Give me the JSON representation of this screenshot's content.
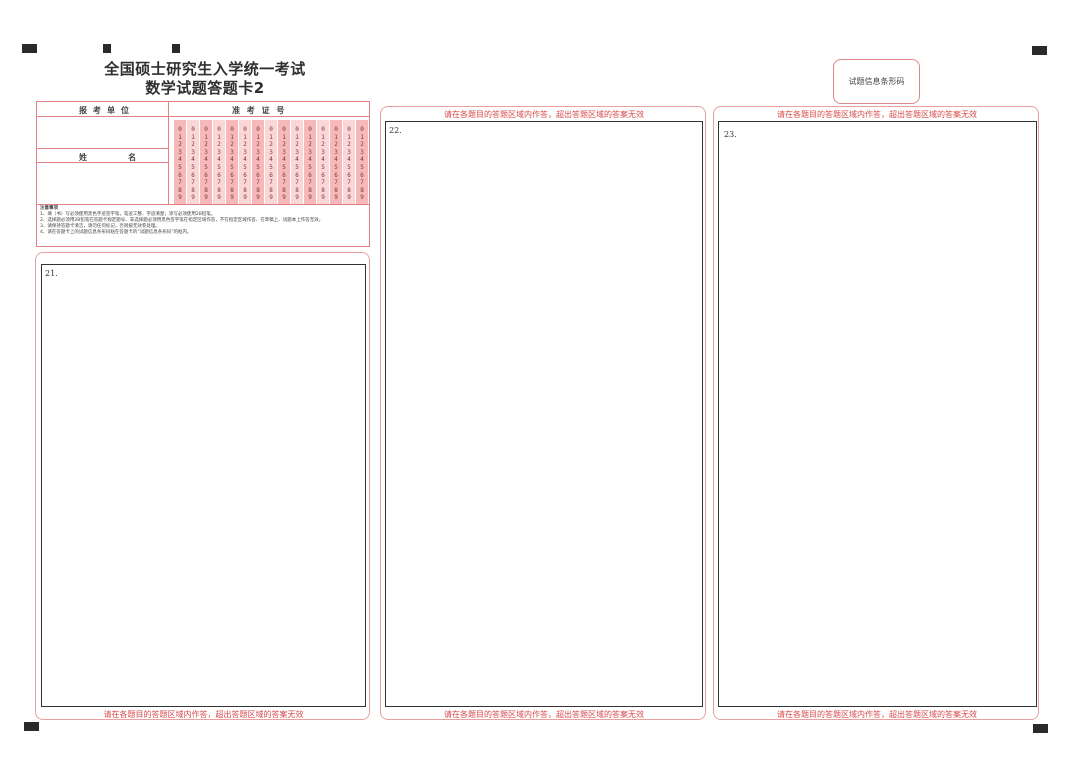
{
  "title_line1": "全国硕士研究生入学统一考试",
  "title_line2": "数学试题答题卡2",
  "barcode_label": "试题信息条形码",
  "info": {
    "unit_label": "报考单位",
    "name_label": "姓    名",
    "exam_no_label": "准 考 证 号",
    "digits": [
      "0",
      "1",
      "2",
      "3",
      "4",
      "5",
      "6",
      "7",
      "8",
      "9"
    ],
    "notes": [
      "注意事项",
      "1、填（书）写必须使用黑色字迹签字笔，笔迹工整、字迹清楚；涂写必须使用2B铅笔。",
      "2、选择题必须用2B铅笔在答题卡规定题号、非选择题必须用黑色签字笔在指定区域作答，不在指定区域作答、在草稿上、试题本上作答无效。",
      "3、请保持答题卡清洁，请勿任何标记，否则按无效卷处理。",
      "4、请在答题卡上的试题信息条形码粘在答题卡的“试题信息条形码”的框内。"
    ]
  },
  "warning_text": "请在各题目的答题区域内作答，超出答题区域的答案无效",
  "questions": [
    "21.",
    "22.",
    "23."
  ]
}
